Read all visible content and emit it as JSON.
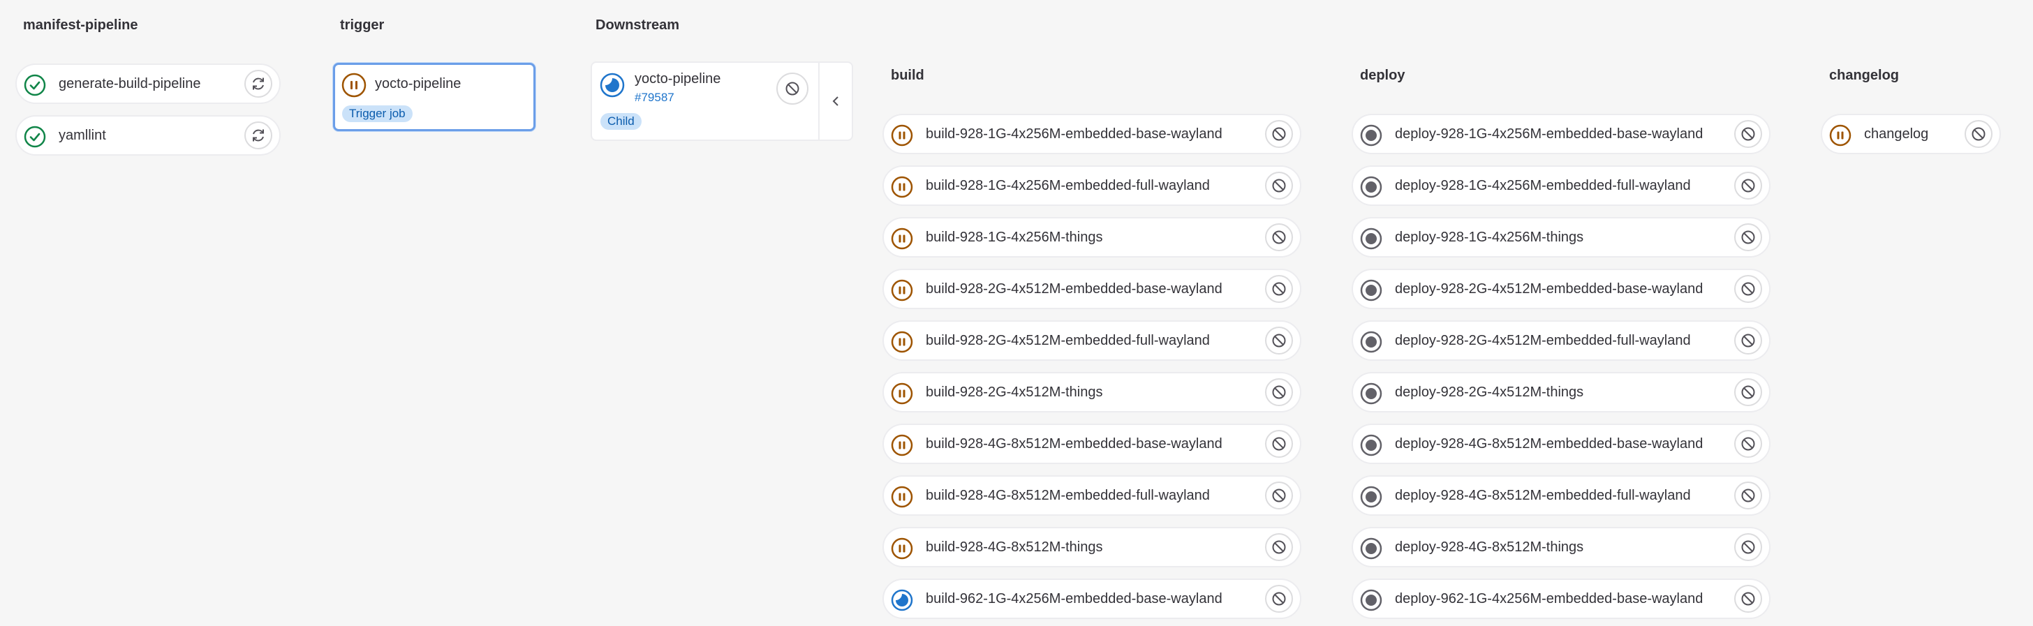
{
  "stages": {
    "manifest": {
      "title": "manifest-pipeline",
      "jobs": [
        {
          "name": "generate-build-pipeline",
          "status": "success",
          "action": "retry"
        },
        {
          "name": "yamllint",
          "status": "success",
          "action": "retry"
        }
      ]
    },
    "trigger": {
      "title": "trigger",
      "job": {
        "name": "yocto-pipeline",
        "status": "manual",
        "badge": "Trigger job"
      }
    },
    "downstream": {
      "title": "Downstream",
      "pipeline": {
        "name": "yocto-pipeline",
        "id": "#79587",
        "status": "running",
        "badge": "Child",
        "action": "cancel"
      }
    },
    "build": {
      "title": "build",
      "jobs": [
        {
          "name": "build-928-1G-4x256M-embedded-base-wayland",
          "status": "manual"
        },
        {
          "name": "build-928-1G-4x256M-embedded-full-wayland",
          "status": "manual"
        },
        {
          "name": "build-928-1G-4x256M-things",
          "status": "manual"
        },
        {
          "name": "build-928-2G-4x512M-embedded-base-wayland",
          "status": "manual"
        },
        {
          "name": "build-928-2G-4x512M-embedded-full-wayland",
          "status": "manual"
        },
        {
          "name": "build-928-2G-4x512M-things",
          "status": "manual"
        },
        {
          "name": "build-928-4G-8x512M-embedded-base-wayland",
          "status": "manual"
        },
        {
          "name": "build-928-4G-8x512M-embedded-full-wayland",
          "status": "manual"
        },
        {
          "name": "build-928-4G-8x512M-things",
          "status": "manual"
        },
        {
          "name": "build-962-1G-4x256M-embedded-base-wayland",
          "status": "running"
        }
      ]
    },
    "deploy": {
      "title": "deploy",
      "jobs": [
        {
          "name": "deploy-928-1G-4x256M-embedded-base-wayland",
          "status": "created"
        },
        {
          "name": "deploy-928-1G-4x256M-embedded-full-wayland",
          "status": "created"
        },
        {
          "name": "deploy-928-1G-4x256M-things",
          "status": "created"
        },
        {
          "name": "deploy-928-2G-4x512M-embedded-base-wayland",
          "status": "created"
        },
        {
          "name": "deploy-928-2G-4x512M-embedded-full-wayland",
          "status": "created"
        },
        {
          "name": "deploy-928-2G-4x512M-things",
          "status": "created"
        },
        {
          "name": "deploy-928-4G-8x512M-embedded-base-wayland",
          "status": "created"
        },
        {
          "name": "deploy-928-4G-8x512M-embedded-full-wayland",
          "status": "created"
        },
        {
          "name": "deploy-928-4G-8x512M-things",
          "status": "created"
        },
        {
          "name": "deploy-962-1G-4x256M-embedded-base-wayland",
          "status": "created"
        }
      ]
    },
    "changelog": {
      "title": "changelog",
      "jobs": [
        {
          "name": "changelog",
          "status": "manual"
        }
      ]
    }
  },
  "colors": {
    "success": "#108548",
    "manual": "#9e5400",
    "running": "#1f75cb",
    "created": "#626168",
    "action_icon": "#535158"
  }
}
